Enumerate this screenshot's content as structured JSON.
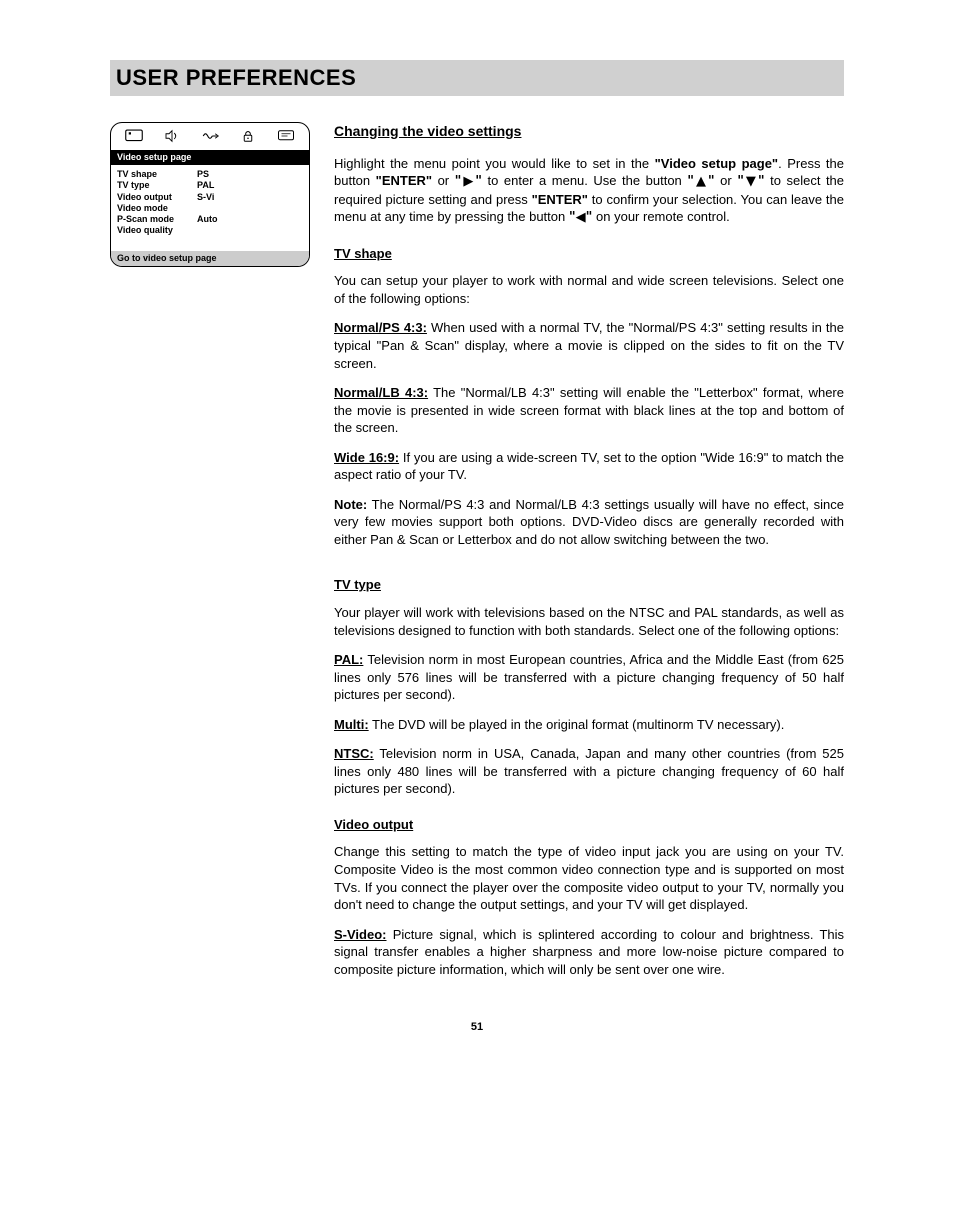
{
  "page_title": "USER PREFERENCES",
  "osd": {
    "heading": "Video setup page",
    "rows": [
      {
        "label": "TV shape",
        "value": "PS"
      },
      {
        "label": "TV type",
        "value": "PAL"
      },
      {
        "label": "Video output",
        "value": "S-Vi"
      },
      {
        "label": "Video mode",
        "value": ""
      },
      {
        "label": "P-Scan mode",
        "value": "Auto"
      },
      {
        "label": "Video quality",
        "value": ""
      }
    ],
    "footer": "Go to video setup page"
  },
  "main": {
    "section_title": "Changing the video settings",
    "intro_parts": {
      "t1": "Highlight the menu point you would like to set in the ",
      "q_page": "\"Video setup page\"",
      "t2": ". Press the button ",
      "q_enter": "\"ENTER\"",
      "t3": " or ",
      "q_right": "\"▶\"",
      "t4": " to enter a menu. Use the button ",
      "q_up": "\"▲\"",
      "t5": " or ",
      "q_down": "\"▼\"",
      "t6": " to select the required picture setting and press ",
      "t7": " to confirm your selection. You can leave the menu at any time by pressing the button ",
      "q_left": "\"◀\"",
      "t8": " on your remote control."
    },
    "tv_shape": {
      "heading": "TV shape",
      "p1": "You can setup your player to work with normal and wide screen televisions. Select one of the following options:",
      "ps_label": "Normal/PS 4:3:",
      "ps_body": " When used with a normal TV, the \"Normal/PS 4:3\" setting results in the typical \"Pan & Scan\" display, where a movie is clipped on the sides to fit on the TV screen.",
      "lb_label": "Normal/LB 4:3:",
      "lb_body": " The \"Normal/LB 4:3\" setting will enable the \"Letterbox\" format, where the movie is presented in wide screen format with black lines at the top and bottom of the screen.",
      "wide_label": "Wide 16:9:",
      "wide_body": " If you are using a wide-screen TV, set to the option \"Wide 16:9\" to match the aspect ratio of your TV.",
      "note_label": "Note:",
      "note_body": " The Normal/PS 4:3 and Normal/LB 4:3 settings usually will have no effect, since very few movies support both options. DVD-Video discs are generally recorded with either Pan & Scan or Letterbox and do not allow switching between the two."
    },
    "tv_type": {
      "heading": "TV type",
      "p1": "Your player will work with televisions based on the NTSC and PAL standards, as well as televisions designed to function with both standards. Select one of the following options:",
      "pal_label": "PAL:",
      "pal_body": " Television norm in most European countries, Africa and the Middle East (from 625 lines only 576 lines will be transferred with a picture changing frequency of 50 half pictures per second).",
      "multi_label": "Multi:",
      "multi_body": " The DVD will be played in the original format (multinorm TV necessary).",
      "ntsc_label": "NTSC:",
      "ntsc_body": " Television norm in USA, Canada, Japan and many other countries (from 525 lines only 480 lines will be transferred with a picture changing frequency of 60 half pictures per second)."
    },
    "video_output": {
      "heading": "Video output",
      "p1": "Change this setting to match the type of video input jack you are using on your TV. Composite Video is the most common video connection type and is supported on most TVs. If you connect the player over the composite video output to your TV, normally you don't need to change the output settings, and your TV will get displayed.",
      "sv_label": "S-Video:",
      "sv_body": " Picture signal, which is splintered according to colour and brightness. This signal transfer enables a higher sharpness and more low-noise picture compared to composite picture information, which will only be sent over one wire."
    }
  },
  "page_number": "51"
}
